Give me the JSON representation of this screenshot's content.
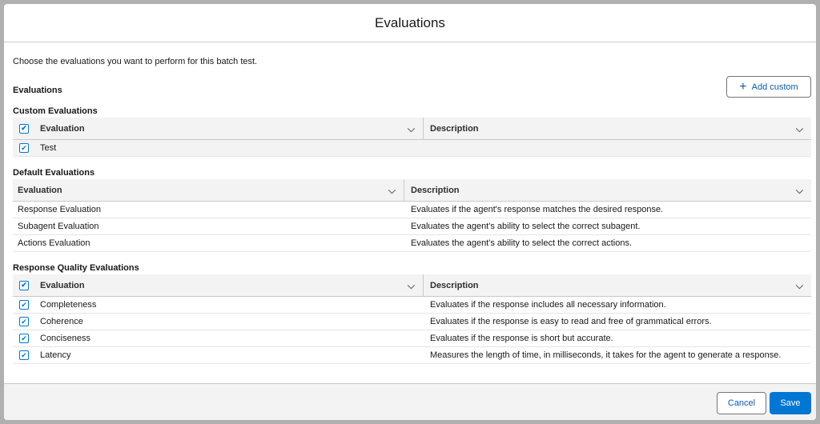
{
  "modal": {
    "title": "Evaluations"
  },
  "intro_text": "Choose the evaluations you want to perform for this batch test.",
  "section_title": "Evaluations",
  "add_custom_label": "Add custom",
  "custom": {
    "title": "Custom Evaluations",
    "col_evaluation": "Evaluation",
    "col_description": "Description",
    "rows": [
      {
        "name": "Test",
        "description": "",
        "checked": true
      }
    ]
  },
  "default": {
    "title": "Default Evaluations",
    "col_evaluation": "Evaluation",
    "col_description": "Description",
    "rows": [
      {
        "name": "Response Evaluation",
        "description": "Evaluates if the agent's response matches the desired response."
      },
      {
        "name": "Subagent Evaluation",
        "description": "Evaluates the agent's ability to select the correct subagent."
      },
      {
        "name": "Actions Evaluation",
        "description": "Evaluates the agent's ability to select the correct actions."
      }
    ]
  },
  "quality": {
    "title": "Response Quality Evaluations",
    "col_evaluation": "Evaluation",
    "col_description": "Description",
    "rows": [
      {
        "name": "Completeness",
        "description": "Evaluates if the response includes all necessary information.",
        "checked": true
      },
      {
        "name": "Coherence",
        "description": "Evaluates if the response is easy to read and free of grammatical errors.",
        "checked": true
      },
      {
        "name": "Conciseness",
        "description": "Evaluates if the response is short but accurate.",
        "checked": true
      },
      {
        "name": "Latency",
        "description": "Measures the length of time, in milliseconds, it takes for the agent to generate a response.",
        "checked": true
      }
    ]
  },
  "footer": {
    "cancel_label": "Cancel",
    "save_label": "Save"
  },
  "icons": {
    "check": "checkmark-icon",
    "chevron": "chevron-down-icon",
    "plus": "plus-icon"
  },
  "colors": {
    "brand": "#0176d3",
    "link": "#0b5cab",
    "header_bg": "#f3f3f3"
  }
}
